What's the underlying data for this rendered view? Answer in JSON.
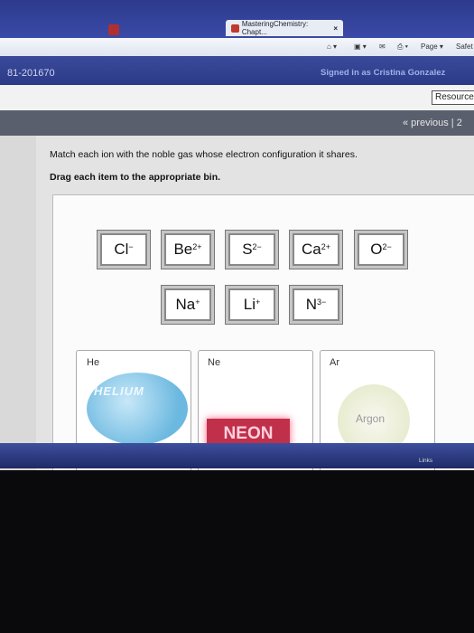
{
  "browser": {
    "tab_title": "MasteringChemistry: Chapt...",
    "tab_close": "×",
    "cmd_page": "Page ▾",
    "cmd_safety": "Safet"
  },
  "header": {
    "user_id": "81-201670",
    "signed_in": "Signed in as Cristina Gonzalez",
    "resources": "Resource",
    "previous": "« previous  |  2"
  },
  "question": {
    "instruction": "Match each ion with the noble gas whose electron configuration it shares.",
    "drag_instruction": "Drag each item to the appropriate bin."
  },
  "tiles": [
    {
      "symbol": "Cl",
      "charge": "−"
    },
    {
      "symbol": "Be",
      "charge": "2+"
    },
    {
      "symbol": "S",
      "charge": "2−"
    },
    {
      "symbol": "Ca",
      "charge": "2+"
    },
    {
      "symbol": "O",
      "charge": "2−"
    },
    {
      "symbol": "Na",
      "charge": "+"
    },
    {
      "symbol": "Li",
      "charge": "+"
    },
    {
      "symbol": "N",
      "charge": "3−"
    }
  ],
  "bins": [
    {
      "label": "He",
      "image_text": "HELIUM"
    },
    {
      "label": "Ne",
      "image_text": "NEON"
    },
    {
      "label": "Ar",
      "image_text": "Argon"
    }
  ],
  "taskbar": {
    "links": "Links"
  }
}
